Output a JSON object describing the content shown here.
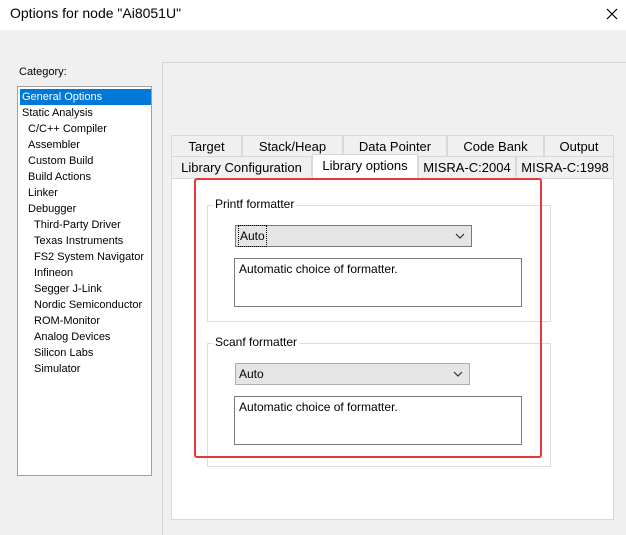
{
  "window": {
    "title": "Options for node \"Ai8051U\""
  },
  "category": {
    "label": "Category:",
    "items": [
      {
        "label": "General Options",
        "selected": true
      },
      {
        "label": "Static Analysis"
      },
      {
        "label": "C/C++ Compiler"
      },
      {
        "label": "Assembler"
      },
      {
        "label": "Custom Build"
      },
      {
        "label": "Build Actions"
      },
      {
        "label": "Linker"
      },
      {
        "label": "Debugger"
      },
      {
        "label": "Third-Party Driver"
      },
      {
        "label": "Texas Instruments"
      },
      {
        "label": "FS2 System Navigator"
      },
      {
        "label": "Infineon"
      },
      {
        "label": "Segger J-Link"
      },
      {
        "label": "Nordic Semiconductor"
      },
      {
        "label": "ROM-Monitor"
      },
      {
        "label": "Analog Devices"
      },
      {
        "label": "Silicon Labs"
      },
      {
        "label": "Simulator"
      }
    ]
  },
  "tabs": {
    "row1": [
      "Target",
      "Stack/Heap",
      "Data Pointer",
      "Code Bank",
      "Output"
    ],
    "row2": [
      "Library Configuration",
      "Library options",
      "MISRA-C:2004",
      "MISRA-C:1998"
    ],
    "active": "Library options"
  },
  "printf": {
    "title": "Printf formatter",
    "selected": "Auto",
    "description": "Automatic choice of formatter."
  },
  "scanf": {
    "title": "Scanf formatter",
    "selected": "Auto",
    "description": "Automatic choice of formatter."
  },
  "colors": {
    "selection": "#0078d7",
    "highlight_box": "#e53935"
  }
}
